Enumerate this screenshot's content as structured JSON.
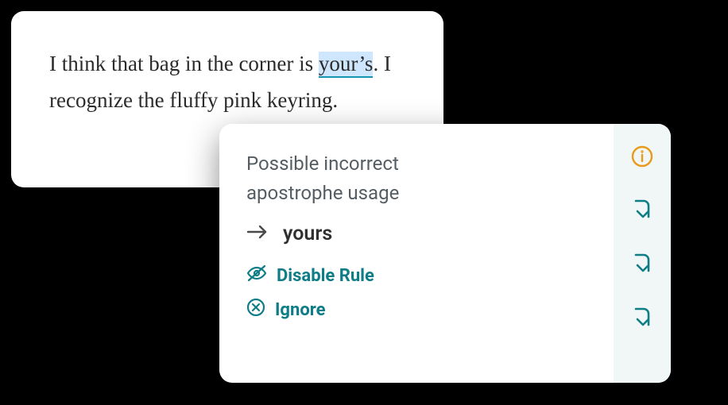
{
  "text_card": {
    "before_highlight": "I think that bag in the corner is ",
    "highlighted_word": "your’s",
    "after_highlight": ". I recognize the fluffy pink keyring."
  },
  "popover": {
    "title": "Possible incorrect apostrophe usage",
    "suggestion": "yours",
    "actions": {
      "disable_rule": "Disable Rule",
      "ignore": "Ignore"
    }
  },
  "rail": {
    "info_icon": "info-icon",
    "nav_icon": "arrow-down-right-icon"
  }
}
